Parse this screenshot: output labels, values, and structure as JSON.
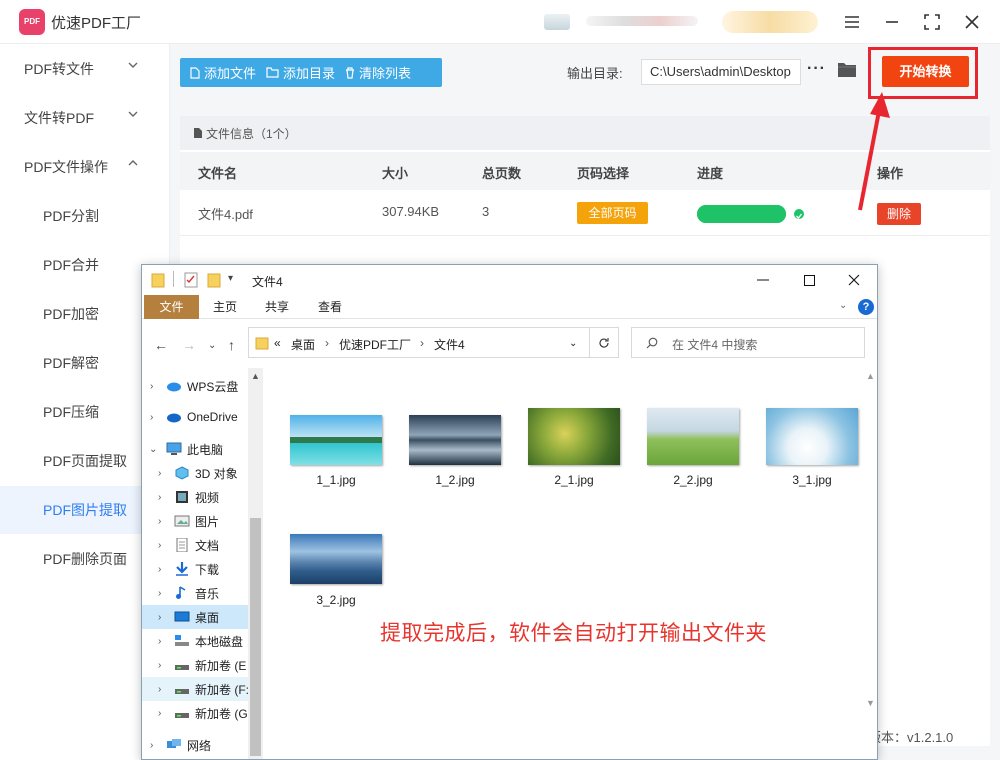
{
  "app": {
    "title": "优速PDF工厂",
    "logo_text": "PDF"
  },
  "sidebar": {
    "items": [
      {
        "label": "PDF转文件"
      },
      {
        "label": "文件转PDF"
      },
      {
        "label": "PDF文件操作"
      },
      {
        "label": "PDF分割"
      },
      {
        "label": "PDF合并"
      },
      {
        "label": "PDF加密"
      },
      {
        "label": "PDF解密"
      },
      {
        "label": "PDF压缩"
      },
      {
        "label": "PDF页面提取"
      },
      {
        "label": "PDF图片提取"
      },
      {
        "label": "PDF删除页面"
      }
    ]
  },
  "toolbar": {
    "add_file": "添加文件",
    "add_dir": "添加目录",
    "clear_list": "清除列表",
    "output_label": "输出目录:",
    "output_path": "C:\\Users\\admin\\Desktop",
    "more": "···",
    "start": "开始转换"
  },
  "file_panel": {
    "header": "文件信息（1个）",
    "columns": [
      "文件名",
      "大小",
      "总页数",
      "页码选择",
      "进度",
      "操作"
    ],
    "rows": [
      {
        "name": "文件4.pdf",
        "size": "307.94KB",
        "pages": "3",
        "page_select": "全部页码",
        "progress": 1.0,
        "action": "删除"
      }
    ]
  },
  "version": "版本：v1.2.1.0",
  "explorer": {
    "title": "文件4",
    "ribbon_tabs": [
      "文件",
      "主页",
      "共享",
      "查看"
    ],
    "breadcrumb": [
      "«",
      "桌面",
      "优速PDF工厂",
      "文件4"
    ],
    "search_placeholder": "在 文件4 中搜索",
    "tree": [
      {
        "label": "WPS云盘"
      },
      {
        "label": "OneDrive"
      },
      {
        "label": "此电脑"
      },
      {
        "label": "3D 对象"
      },
      {
        "label": "视频"
      },
      {
        "label": "图片"
      },
      {
        "label": "文档"
      },
      {
        "label": "下载"
      },
      {
        "label": "音乐"
      },
      {
        "label": "桌面"
      },
      {
        "label": "本地磁盘"
      },
      {
        "label": "新加卷 (E"
      },
      {
        "label": "新加卷 (F:"
      },
      {
        "label": "新加卷 (G"
      },
      {
        "label": "网络"
      }
    ],
    "files": [
      {
        "name": "1_1.jpg"
      },
      {
        "name": "1_2.jpg"
      },
      {
        "name": "2_1.jpg"
      },
      {
        "name": "2_2.jpg"
      },
      {
        "name": "3_1.jpg"
      },
      {
        "name": "3_2.jpg"
      }
    ]
  },
  "caption": "提取完成后，软件会自动打开输出文件夹",
  "colors": {
    "accent_blue": "#3fa9e6",
    "start_orange": "#f24410",
    "highlight_red": "#e8262f",
    "badge_orange": "#f5a30b",
    "progress_green": "#1ec368",
    "sidebar_active": "#2f7ef0"
  }
}
